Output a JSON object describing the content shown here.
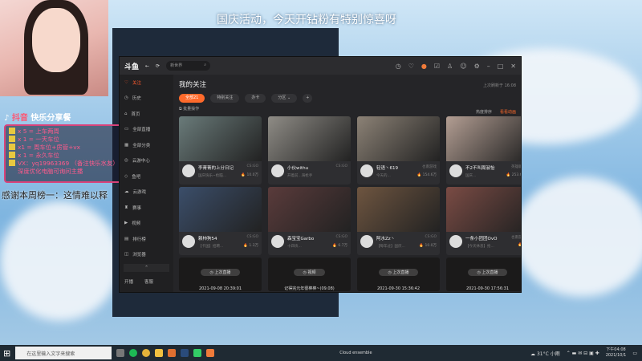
{
  "overlay": {
    "banner": "国庆活动，今天开钻粉有特别惊喜呀",
    "promo_brand": "抖音",
    "promo_title": "快乐分享餐",
    "perks": [
      "x 5 = 上车两周",
      "x 1 = 一天车位",
      "x1 = 周车位+房管+vx",
      "x 1 = 永久车位",
      "VX：yq19963369 （备注快乐水友）",
      "深度优化电脑可询问主播"
    ],
    "thanks": "感谢本周榜一：这情难以释"
  },
  "window": {
    "logo": "斗鱼",
    "search": "新世界",
    "sidebar": [
      "关注",
      "历史",
      "首页",
      "全部直播",
      "全部分类",
      "云游中心",
      "鱼吧",
      "云游戏",
      "赛事",
      "视频",
      "排行榜",
      "浏览器"
    ],
    "sidebar_bottom": [
      "开播",
      "客服"
    ],
    "heading": "我的关注",
    "updated": "上次刷新于 16:08",
    "chips": [
      "全部21",
      "特别关注",
      "办卡",
      "分区"
    ],
    "sort": [
      "热度排序",
      "看看动画"
    ],
    "batch": "批量操作",
    "cards": [
      {
        "name": "李菁菁的上分日记",
        "cat": "CS:GO",
        "sub": "国庆快乐~枪脑...",
        "hot": "10.0万",
        "thumb": "#6a7b7a"
      },
      {
        "name": "小伙withu",
        "cat": "CS:GO",
        "sub": "开着前...海枪手",
        "hot": "",
        "thumb": "#8f8c86"
      },
      {
        "name": "轻语丶619",
        "cat": "也南游戏",
        "sub": "今天的...",
        "hot": "154.6万",
        "thumb": "#8c8276"
      },
      {
        "name": "不2不叫周淑怡",
        "cat": "英雄联盟",
        "sub": "国庆...",
        "hot": "253.6万",
        "thumb": "#b39e93"
      },
      {
        "name": "赖柿狗54",
        "cat": "CS:GO",
        "sub": "【卡国】招聘...",
        "hot": "1.3万",
        "thumb": "#3b4e6a"
      },
      {
        "name": "森宝宝Garbo",
        "cat": "CS:GO",
        "sub": "十四块...",
        "hot": "6.7万",
        "thumb": "#5a3b3b"
      },
      {
        "name": "阿水Zz丶",
        "cat": "CS:GO",
        "sub": "【每年过】国庆...",
        "hot": "10.0万",
        "thumb": "#6e5540"
      },
      {
        "name": "一条小团团OvO",
        "cat": "也南游戏",
        "sub": "【今天休息】抢...",
        "hot": "0",
        "thumb": "#7a4b44"
      }
    ],
    "past": [
      {
        "label": "上次直播",
        "date": "2021-09-08 20:39:01"
      },
      {
        "label": "视频",
        "date": "记得完元年很棒棒~(09.08)"
      },
      {
        "label": "上次直播",
        "date": "2021-09-30 15:36:42"
      },
      {
        "label": "上次直播",
        "date": "2021-09-30 17:56:31"
      }
    ]
  },
  "taskbar": {
    "search": "在这里输入文字来搜索",
    "media": "Cloud ensemble",
    "weather": "31°C 小雨",
    "time": "下午04:08",
    "date": "2021/10/1"
  }
}
